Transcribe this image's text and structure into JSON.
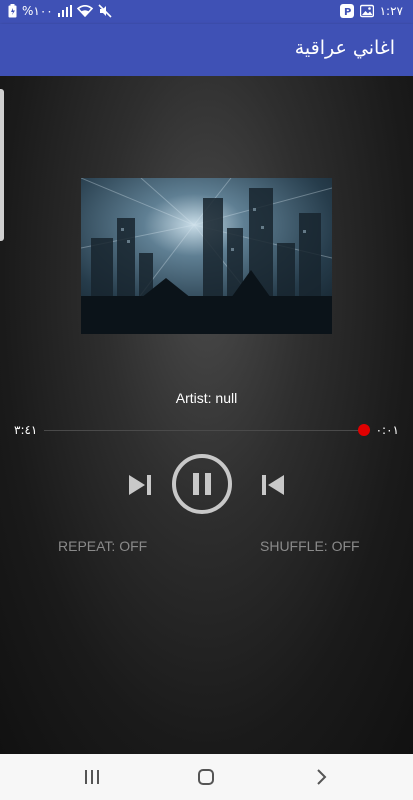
{
  "status_bar": {
    "battery_text": "%١٠٠",
    "time": "١:٢٧",
    "icons": [
      "battery-icon",
      "signal-icon",
      "wifi-icon",
      "mute-icon",
      "parking-app-icon",
      "gallery-icon"
    ]
  },
  "app_bar": {
    "title": "اغاني عراقية"
  },
  "player": {
    "artist": "Artist: null",
    "elapsed": "٣:٤١",
    "total": "٠:٠١",
    "progress": 0.0
  },
  "options": {
    "repeat": "REPEAT: OFF",
    "shuffle": "SHUFFLE: OFF"
  },
  "nav": {
    "icons": [
      "recent-apps-icon",
      "home-icon",
      "back-icon"
    ]
  },
  "colors": {
    "primary": "#3f51b5",
    "seek_thumb": "#e00000",
    "controls": "#c8c8c8"
  }
}
